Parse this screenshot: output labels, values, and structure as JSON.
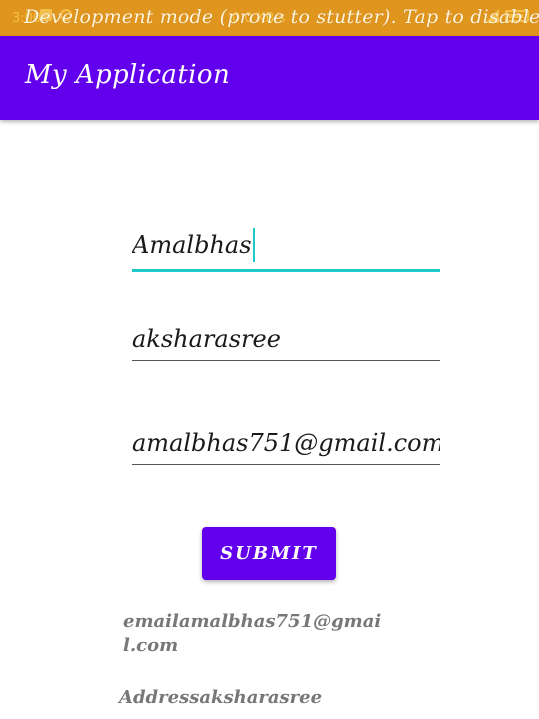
{
  "status_bar": {
    "time": "3:00",
    "center_text": "0.0 KB/s",
    "dev_banner": "Development mode (prone to stutter). Tap to disable."
  },
  "app_bar": {
    "title": "My Application"
  },
  "form": {
    "name_value": "Amalbhas",
    "address_value": "aksharasree",
    "email_value": "amalbhas751@gmail.com",
    "submit_label": "SUBMIT"
  },
  "output": {
    "email_text": "emailamalbhas751@gmail.com",
    "address_text": "Addressaksharasree"
  },
  "colors": {
    "status_bar": "#e0951f",
    "primary": "#6200ee",
    "accent": "#1ec9c9",
    "output_text": "#777777"
  },
  "icons": [
    "notification-icon",
    "sync-icon",
    "signal-icon",
    "battery-icon"
  ]
}
